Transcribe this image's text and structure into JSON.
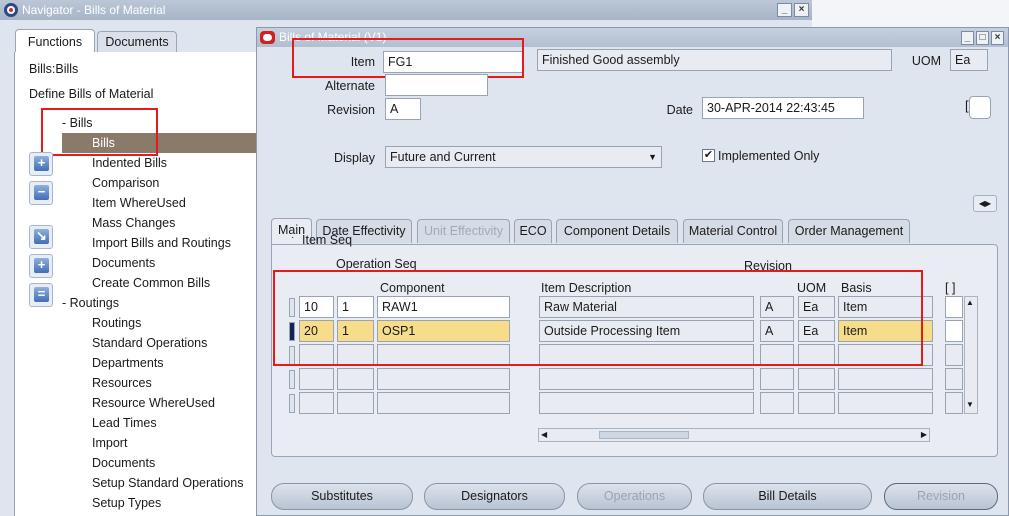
{
  "navigator": {
    "title": "Navigator - Bills of Material",
    "tabs": [
      "Functions",
      "Documents"
    ],
    "heading1": "Bills:Bills",
    "heading2": "Define Bills of Material",
    "tree": [
      {
        "label": "-  Bills",
        "level": 0
      },
      {
        "label": "Bills",
        "level": 1,
        "selected": true
      },
      {
        "label": "Indented Bills",
        "level": 1
      },
      {
        "label": "Comparison",
        "level": 1
      },
      {
        "label": "Item WhereUsed",
        "level": 1
      },
      {
        "label": "Mass Changes",
        "level": 1
      },
      {
        "label": "Import Bills and Routings",
        "level": 1
      },
      {
        "label": "Documents",
        "level": 1
      },
      {
        "label": "Create Common Bills",
        "level": 1
      },
      {
        "label": "-  Routings",
        "level": 0
      },
      {
        "label": "Routings",
        "level": 1
      },
      {
        "label": "Standard Operations",
        "level": 1
      },
      {
        "label": "Departments",
        "level": 1
      },
      {
        "label": "Resources",
        "level": 1
      },
      {
        "label": "Resource WhereUsed",
        "level": 1
      },
      {
        "label": "Lead Times",
        "level": 1
      },
      {
        "label": "Import",
        "level": 1
      },
      {
        "label": "Documents",
        "level": 1
      },
      {
        "label": "Setup Standard Operations",
        "level": 1
      },
      {
        "label": "Setup Types",
        "level": 1
      }
    ],
    "side_buttons": [
      "plus-icon",
      "minus-icon",
      "expand-branch-icon",
      "expand-all-icon",
      "collapse-all-icon"
    ]
  },
  "bom": {
    "title": "Bills of Material (V1)",
    "item_label": "Item",
    "item_value": "FG1",
    "item_description": "Finished Good assembly",
    "uom_label": "UOM",
    "uom_value": "Ea",
    "alternate_label": "Alternate",
    "alternate_value": "",
    "revision_label": "Revision",
    "revision_value": "A",
    "date_label": "Date",
    "date_value": "30-APR-2014 22:43:45",
    "display_label": "Display",
    "display_value": "Future and Current",
    "implemented_only_label": "Implemented Only",
    "implemented_only_checked": true,
    "tabs": [
      {
        "label": "Main",
        "active": true
      },
      {
        "label": "Date Effectivity"
      },
      {
        "label": "Unit Effectivity",
        "disabled": true
      },
      {
        "label": "ECO"
      },
      {
        "label": "Component Details"
      },
      {
        "label": "Material Control"
      },
      {
        "label": "Order Management"
      }
    ],
    "grid": {
      "item_seq_label": "Item Seq",
      "op_seq_label": "Operation Seq",
      "component_label": "Component",
      "description_label": "Item Description",
      "revision_label": "Revision",
      "uom_label": "UOM",
      "basis_label": "Basis",
      "flex_label": "[ ]",
      "rows": [
        {
          "item_seq": "10",
          "op_seq": "1",
          "component": "RAW1",
          "description": "Raw Material",
          "revision": "A",
          "uom": "Ea",
          "basis": "Item",
          "current": false
        },
        {
          "item_seq": "20",
          "op_seq": "1",
          "component": "OSP1",
          "description": "Outside Processing Item",
          "revision": "A",
          "uom": "Ea",
          "basis": "Item",
          "current": true
        },
        {
          "item_seq": "",
          "op_seq": "",
          "component": "",
          "description": "",
          "revision": "",
          "uom": "",
          "basis": "",
          "current": false
        },
        {
          "item_seq": "",
          "op_seq": "",
          "component": "",
          "description": "",
          "revision": "",
          "uom": "",
          "basis": "",
          "current": false
        },
        {
          "item_seq": "",
          "op_seq": "",
          "component": "",
          "description": "",
          "revision": "",
          "uom": "",
          "basis": "",
          "current": false
        }
      ]
    },
    "buttons": [
      {
        "label": "Substitutes",
        "mnemonic": "u"
      },
      {
        "label": "Designators",
        "mnemonic": "D"
      },
      {
        "label": "Operations",
        "disabled": true
      },
      {
        "label": "Bill Details",
        "mnemonic": "B"
      },
      {
        "label": "Revision",
        "disabled": true
      }
    ],
    "colors": {
      "highlight_yellow": "#f7dd8a",
      "annotation_red": "#e41b1b",
      "selected_tree": "#8a7a6a"
    }
  }
}
